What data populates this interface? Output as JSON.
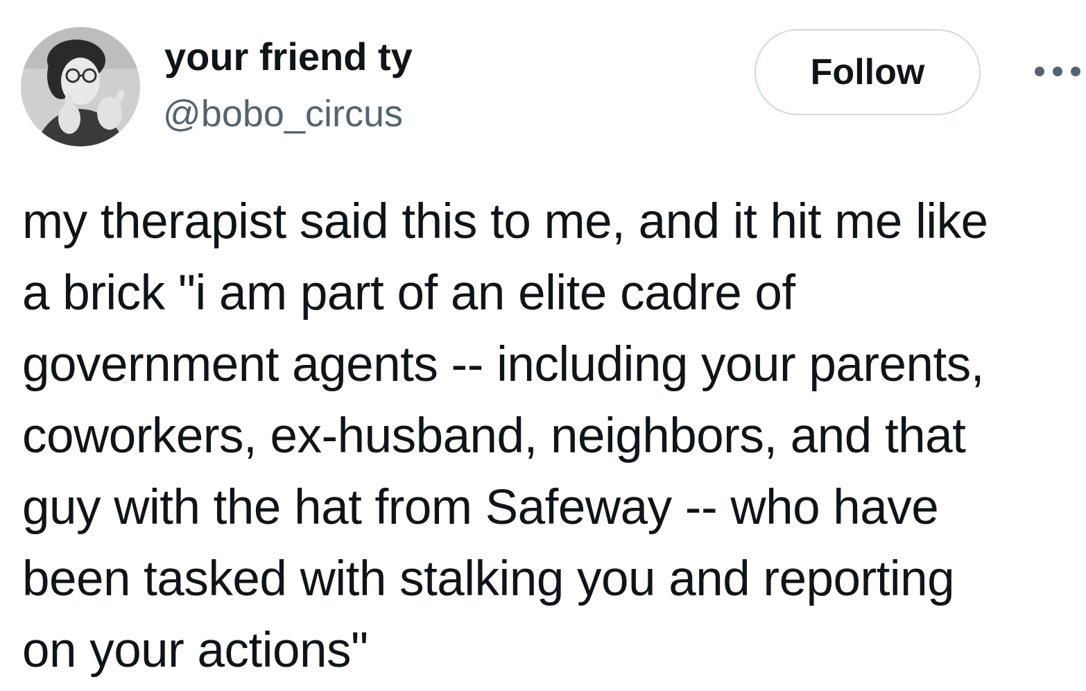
{
  "author": {
    "display_name": "your friend ty",
    "handle": "@bobo_circus",
    "avatar_icon": "profile-photo"
  },
  "actions": {
    "follow_label": "Follow",
    "more_icon": "more-horizontal-icon"
  },
  "tweet": {
    "lines": [
      "my therapist said this to me, and it hit me like",
      "a brick \"i am part of an elite cadre of",
      "government agents -- including your parents,",
      "coworkers, ex-husband, neighbors, and that",
      "guy with the hat from Safeway -- who have",
      "been tasked with stalking you and reporting",
      "on your actions\""
    ]
  },
  "colors": {
    "text_primary": "#0f1419",
    "text_secondary": "#536471",
    "border": "#cfd9de",
    "background": "#ffffff"
  }
}
